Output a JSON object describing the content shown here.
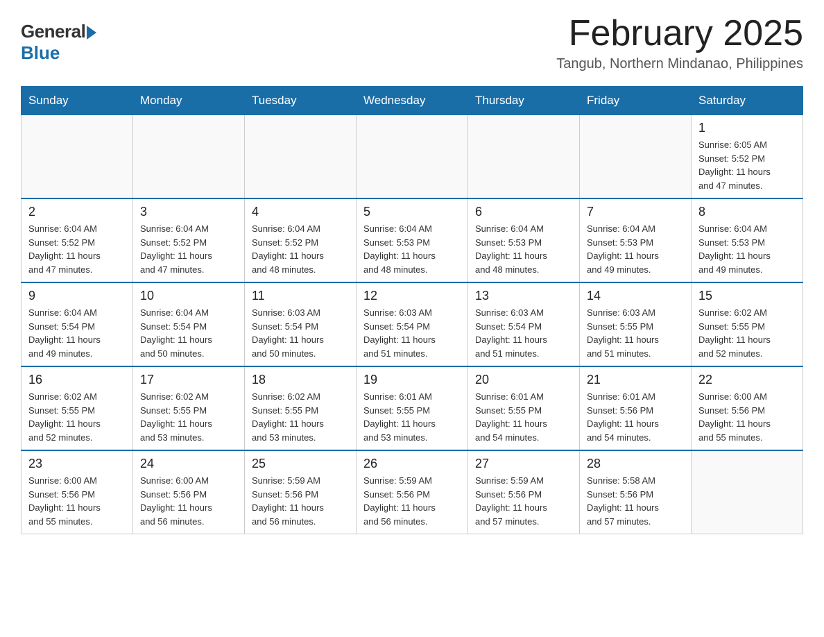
{
  "header": {
    "logo_general": "General",
    "logo_blue": "Blue",
    "month_title": "February 2025",
    "location": "Tangub, Northern Mindanao, Philippines"
  },
  "days_of_week": [
    "Sunday",
    "Monday",
    "Tuesday",
    "Wednesday",
    "Thursday",
    "Friday",
    "Saturday"
  ],
  "weeks": [
    {
      "days": [
        {
          "date": "",
          "info": "",
          "empty": true
        },
        {
          "date": "",
          "info": "",
          "empty": true
        },
        {
          "date": "",
          "info": "",
          "empty": true
        },
        {
          "date": "",
          "info": "",
          "empty": true
        },
        {
          "date": "",
          "info": "",
          "empty": true
        },
        {
          "date": "",
          "info": "",
          "empty": true
        },
        {
          "date": "1",
          "info": "Sunrise: 6:05 AM\nSunset: 5:52 PM\nDaylight: 11 hours\nand 47 minutes.",
          "empty": false
        }
      ]
    },
    {
      "days": [
        {
          "date": "2",
          "info": "Sunrise: 6:04 AM\nSunset: 5:52 PM\nDaylight: 11 hours\nand 47 minutes.",
          "empty": false
        },
        {
          "date": "3",
          "info": "Sunrise: 6:04 AM\nSunset: 5:52 PM\nDaylight: 11 hours\nand 47 minutes.",
          "empty": false
        },
        {
          "date": "4",
          "info": "Sunrise: 6:04 AM\nSunset: 5:52 PM\nDaylight: 11 hours\nand 48 minutes.",
          "empty": false
        },
        {
          "date": "5",
          "info": "Sunrise: 6:04 AM\nSunset: 5:53 PM\nDaylight: 11 hours\nand 48 minutes.",
          "empty": false
        },
        {
          "date": "6",
          "info": "Sunrise: 6:04 AM\nSunset: 5:53 PM\nDaylight: 11 hours\nand 48 minutes.",
          "empty": false
        },
        {
          "date": "7",
          "info": "Sunrise: 6:04 AM\nSunset: 5:53 PM\nDaylight: 11 hours\nand 49 minutes.",
          "empty": false
        },
        {
          "date": "8",
          "info": "Sunrise: 6:04 AM\nSunset: 5:53 PM\nDaylight: 11 hours\nand 49 minutes.",
          "empty": false
        }
      ]
    },
    {
      "days": [
        {
          "date": "9",
          "info": "Sunrise: 6:04 AM\nSunset: 5:54 PM\nDaylight: 11 hours\nand 49 minutes.",
          "empty": false
        },
        {
          "date": "10",
          "info": "Sunrise: 6:04 AM\nSunset: 5:54 PM\nDaylight: 11 hours\nand 50 minutes.",
          "empty": false
        },
        {
          "date": "11",
          "info": "Sunrise: 6:03 AM\nSunset: 5:54 PM\nDaylight: 11 hours\nand 50 minutes.",
          "empty": false
        },
        {
          "date": "12",
          "info": "Sunrise: 6:03 AM\nSunset: 5:54 PM\nDaylight: 11 hours\nand 51 minutes.",
          "empty": false
        },
        {
          "date": "13",
          "info": "Sunrise: 6:03 AM\nSunset: 5:54 PM\nDaylight: 11 hours\nand 51 minutes.",
          "empty": false
        },
        {
          "date": "14",
          "info": "Sunrise: 6:03 AM\nSunset: 5:55 PM\nDaylight: 11 hours\nand 51 minutes.",
          "empty": false
        },
        {
          "date": "15",
          "info": "Sunrise: 6:02 AM\nSunset: 5:55 PM\nDaylight: 11 hours\nand 52 minutes.",
          "empty": false
        }
      ]
    },
    {
      "days": [
        {
          "date": "16",
          "info": "Sunrise: 6:02 AM\nSunset: 5:55 PM\nDaylight: 11 hours\nand 52 minutes.",
          "empty": false
        },
        {
          "date": "17",
          "info": "Sunrise: 6:02 AM\nSunset: 5:55 PM\nDaylight: 11 hours\nand 53 minutes.",
          "empty": false
        },
        {
          "date": "18",
          "info": "Sunrise: 6:02 AM\nSunset: 5:55 PM\nDaylight: 11 hours\nand 53 minutes.",
          "empty": false
        },
        {
          "date": "19",
          "info": "Sunrise: 6:01 AM\nSunset: 5:55 PM\nDaylight: 11 hours\nand 53 minutes.",
          "empty": false
        },
        {
          "date": "20",
          "info": "Sunrise: 6:01 AM\nSunset: 5:55 PM\nDaylight: 11 hours\nand 54 minutes.",
          "empty": false
        },
        {
          "date": "21",
          "info": "Sunrise: 6:01 AM\nSunset: 5:56 PM\nDaylight: 11 hours\nand 54 minutes.",
          "empty": false
        },
        {
          "date": "22",
          "info": "Sunrise: 6:00 AM\nSunset: 5:56 PM\nDaylight: 11 hours\nand 55 minutes.",
          "empty": false
        }
      ]
    },
    {
      "days": [
        {
          "date": "23",
          "info": "Sunrise: 6:00 AM\nSunset: 5:56 PM\nDaylight: 11 hours\nand 55 minutes.",
          "empty": false
        },
        {
          "date": "24",
          "info": "Sunrise: 6:00 AM\nSunset: 5:56 PM\nDaylight: 11 hours\nand 56 minutes.",
          "empty": false
        },
        {
          "date": "25",
          "info": "Sunrise: 5:59 AM\nSunset: 5:56 PM\nDaylight: 11 hours\nand 56 minutes.",
          "empty": false
        },
        {
          "date": "26",
          "info": "Sunrise: 5:59 AM\nSunset: 5:56 PM\nDaylight: 11 hours\nand 56 minutes.",
          "empty": false
        },
        {
          "date": "27",
          "info": "Sunrise: 5:59 AM\nSunset: 5:56 PM\nDaylight: 11 hours\nand 57 minutes.",
          "empty": false
        },
        {
          "date": "28",
          "info": "Sunrise: 5:58 AM\nSunset: 5:56 PM\nDaylight: 11 hours\nand 57 minutes.",
          "empty": false
        },
        {
          "date": "",
          "info": "",
          "empty": true
        }
      ]
    }
  ]
}
